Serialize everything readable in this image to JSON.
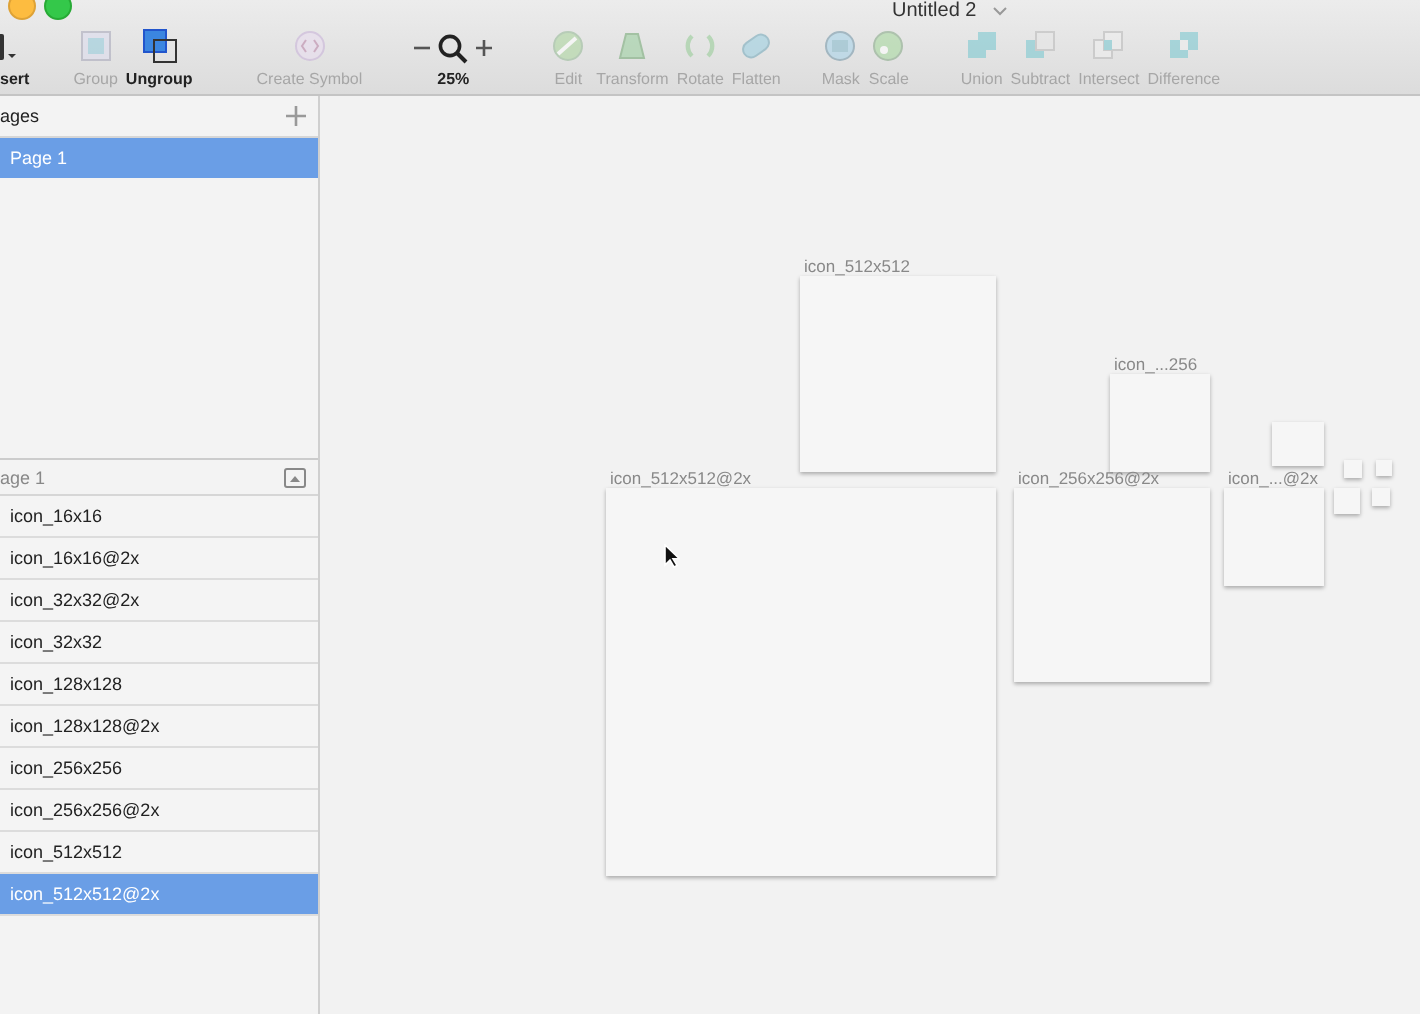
{
  "window": {
    "title": "Untitled 2"
  },
  "toolbar": [
    {
      "items": [
        {
          "label": "sert",
          "kind": "insert",
          "disabled": false
        }
      ]
    },
    {
      "items": [
        {
          "label": "Group",
          "kind": "group",
          "disabled": true
        },
        {
          "label": "Ungroup",
          "kind": "ungroup",
          "disabled": false
        }
      ]
    },
    {
      "items": [
        {
          "label": "Create Symbol",
          "kind": "symbol",
          "disabled": true
        }
      ]
    },
    {
      "items": [
        {
          "label": "25%",
          "kind": "zoom",
          "disabled": false
        }
      ]
    },
    {
      "items": [
        {
          "label": "Edit",
          "kind": "edit",
          "disabled": true
        },
        {
          "label": "Transform",
          "kind": "transform",
          "disabled": true
        },
        {
          "label": "Rotate",
          "kind": "rotate",
          "disabled": true
        },
        {
          "label": "Flatten",
          "kind": "flatten",
          "disabled": true
        }
      ]
    },
    {
      "items": [
        {
          "label": "Mask",
          "kind": "mask",
          "disabled": true
        },
        {
          "label": "Scale",
          "kind": "scale",
          "disabled": true
        }
      ]
    },
    {
      "items": [
        {
          "label": "Union",
          "kind": "union",
          "disabled": true
        },
        {
          "label": "Subtract",
          "kind": "subtract",
          "disabled": true
        },
        {
          "label": "Intersect",
          "kind": "intersect",
          "disabled": true
        },
        {
          "label": "Difference",
          "kind": "difference",
          "disabled": true
        }
      ]
    }
  ],
  "pages": {
    "title": "ages",
    "items": [
      {
        "label": "Page 1",
        "selected": true
      }
    ]
  },
  "layers": {
    "title": "age 1",
    "items": [
      {
        "label": "icon_16x16",
        "selected": false
      },
      {
        "label": "icon_16x16@2x",
        "selected": false
      },
      {
        "label": "icon_32x32@2x",
        "selected": false
      },
      {
        "label": "icon_32x32",
        "selected": false
      },
      {
        "label": "icon_128x128",
        "selected": false
      },
      {
        "label": "icon_128x128@2x",
        "selected": false
      },
      {
        "label": "icon_256x256",
        "selected": false
      },
      {
        "label": "icon_256x256@2x",
        "selected": false
      },
      {
        "label": "icon_512x512",
        "selected": false
      },
      {
        "label": "icon_512x512@2x",
        "selected": true
      }
    ]
  },
  "canvas": {
    "artboards": [
      {
        "kind": "named",
        "label": "icon_512x512"
      },
      {
        "kind": "named",
        "label": "icon_...256"
      },
      {
        "kind": "named",
        "label": "icon_512x512@2x"
      },
      {
        "kind": "named",
        "label": "icon_256x256@2x"
      },
      {
        "kind": "named",
        "label": "icon_...@2x"
      },
      {
        "kind": "unnamed"
      },
      {
        "kind": "unnamed"
      },
      {
        "kind": "unnamed"
      },
      {
        "kind": "unnamed"
      },
      {
        "kind": "unnamed"
      }
    ]
  }
}
